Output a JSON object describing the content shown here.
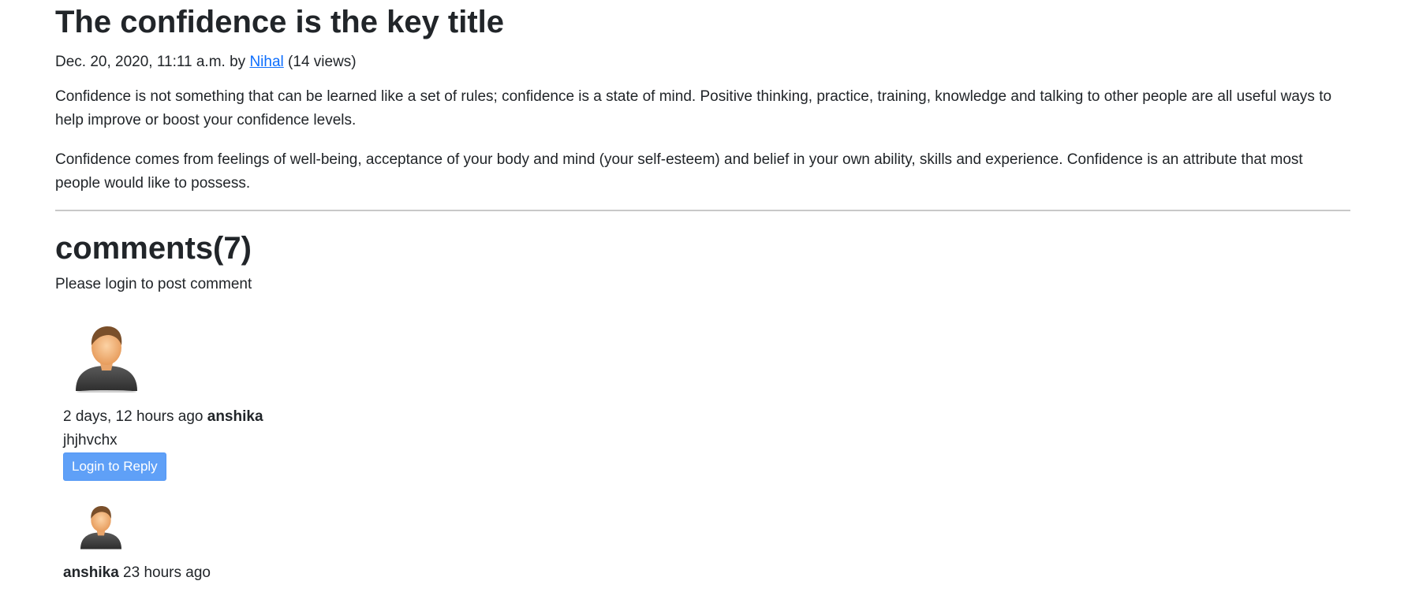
{
  "post": {
    "title": "The confidence is the key title",
    "date": "Dec. 20, 2020, 11:11 a.m. by",
    "author": "Nihal",
    "views": "(14 views)",
    "paragraphs": [
      "Confidence is not something that can be learned like a set of rules; confidence is a state of mind. Positive thinking, practice, training, knowledge and talking to other people are all useful ways to help improve or boost your confidence levels.",
      "Confidence comes from feelings of well-being, acceptance of your body and mind (your self-esteem) and belief in your own ability, skills and experience. Confidence is an attribute that most people would like to possess."
    ]
  },
  "comments_section": {
    "heading": "comments(7)",
    "login_note": "Please login to post comment"
  },
  "comments": [
    {
      "avatar_icon": "user-avatar-icon",
      "time": "2 days, 12 hours ago",
      "user": "anshika",
      "text": "jhjhvchx",
      "reply_label": "Login to Reply"
    },
    {
      "avatar_icon": "user-avatar-icon",
      "user": "anshika",
      "time": "23 hours ago"
    }
  ],
  "colors": {
    "link": "#0d6efd",
    "button": "#5fa0f7",
    "text": "#212529"
  }
}
